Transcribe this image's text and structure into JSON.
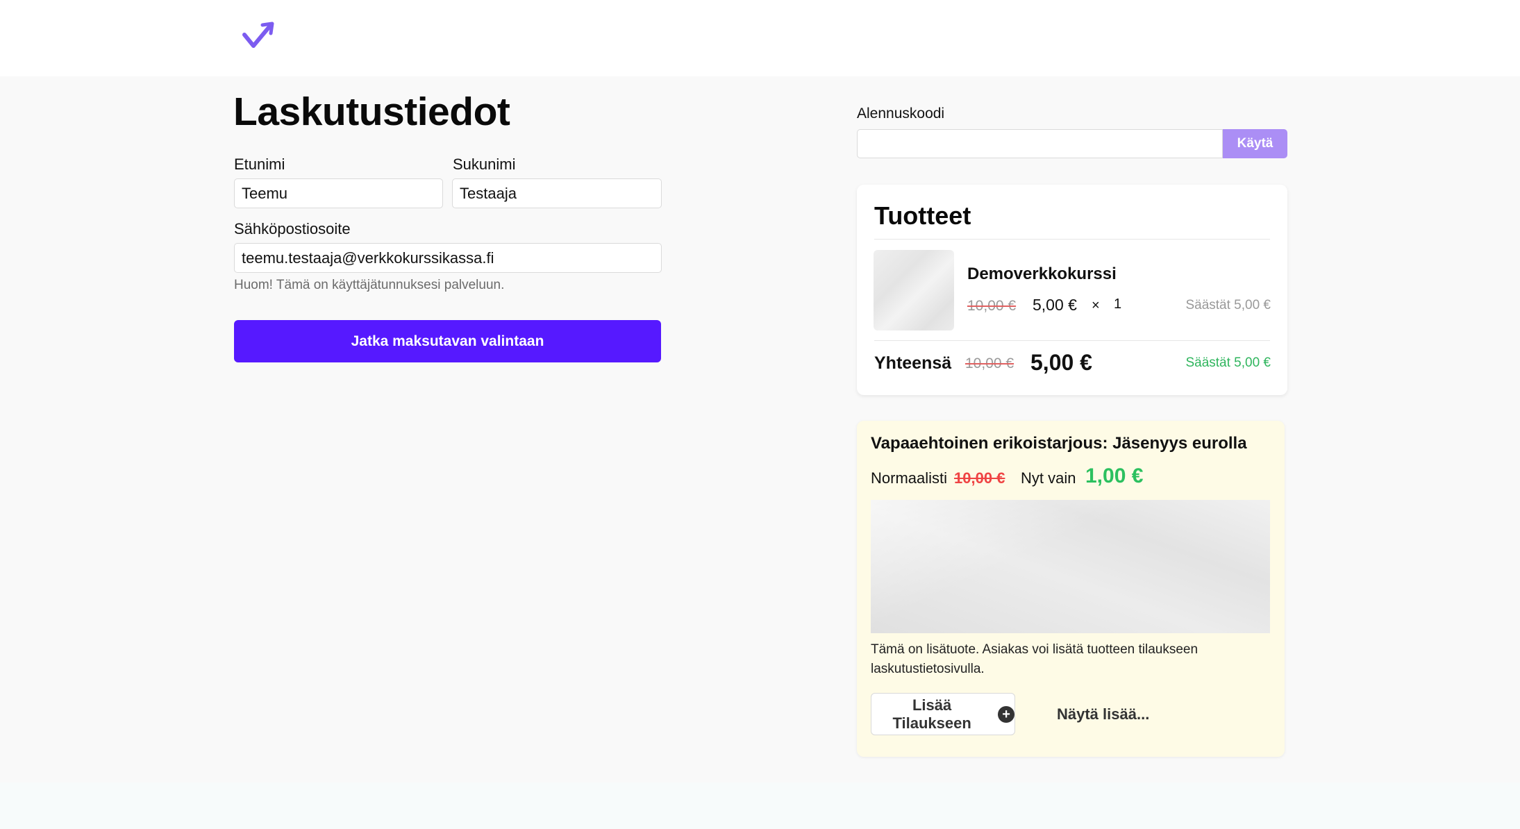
{
  "header": {
    "logo_icon": "check-arrow-logo",
    "brand_color": "#7c5cf0"
  },
  "form": {
    "title": "Laskutustiedot",
    "first_name_label": "Etunimi",
    "first_name_value": "Teemu",
    "last_name_label": "Sukunimi",
    "last_name_value": "Testaaja",
    "email_label": "Sähköpostiosoite",
    "email_value": "teemu.testaaja@verkkokurssikassa.fi",
    "email_hint": "Huom! Tämä on käyttäjätunnuksesi palveluun.",
    "continue_button": "Jatka maksutavan valintaan",
    "accent_color": "#5619ff"
  },
  "discount": {
    "label": "Alennuskoodi",
    "value": "",
    "apply_button": "Käytä"
  },
  "products": {
    "title": "Tuotteet",
    "items": [
      {
        "name": "Demoverkkokurssi",
        "old_price": "10,00 €",
        "price": "5,00 €",
        "times": "×",
        "quantity": "1",
        "savings": "Säästät 5,00 €"
      }
    ],
    "total": {
      "label": "Yhteensä",
      "old_price": "10,00 €",
      "price": "5,00 €",
      "savings": "Säästät 5,00 €"
    }
  },
  "offer": {
    "title": "Vapaaehtoinen erikoistarjous: Jäsenyys eurolla",
    "normal_label": "Normaalisti",
    "normal_price": "10,00 €",
    "now_label": "Nyt vain",
    "now_price": "1,00 €",
    "description": "Tämä on lisätuote. Asiakas voi lisätä tuotteen tilaukseen laskutustietosivulla.",
    "add_button": "Lisää Tilaukseen",
    "add_icon": "plus-circle-icon",
    "more_link": "Näytä lisää..."
  }
}
